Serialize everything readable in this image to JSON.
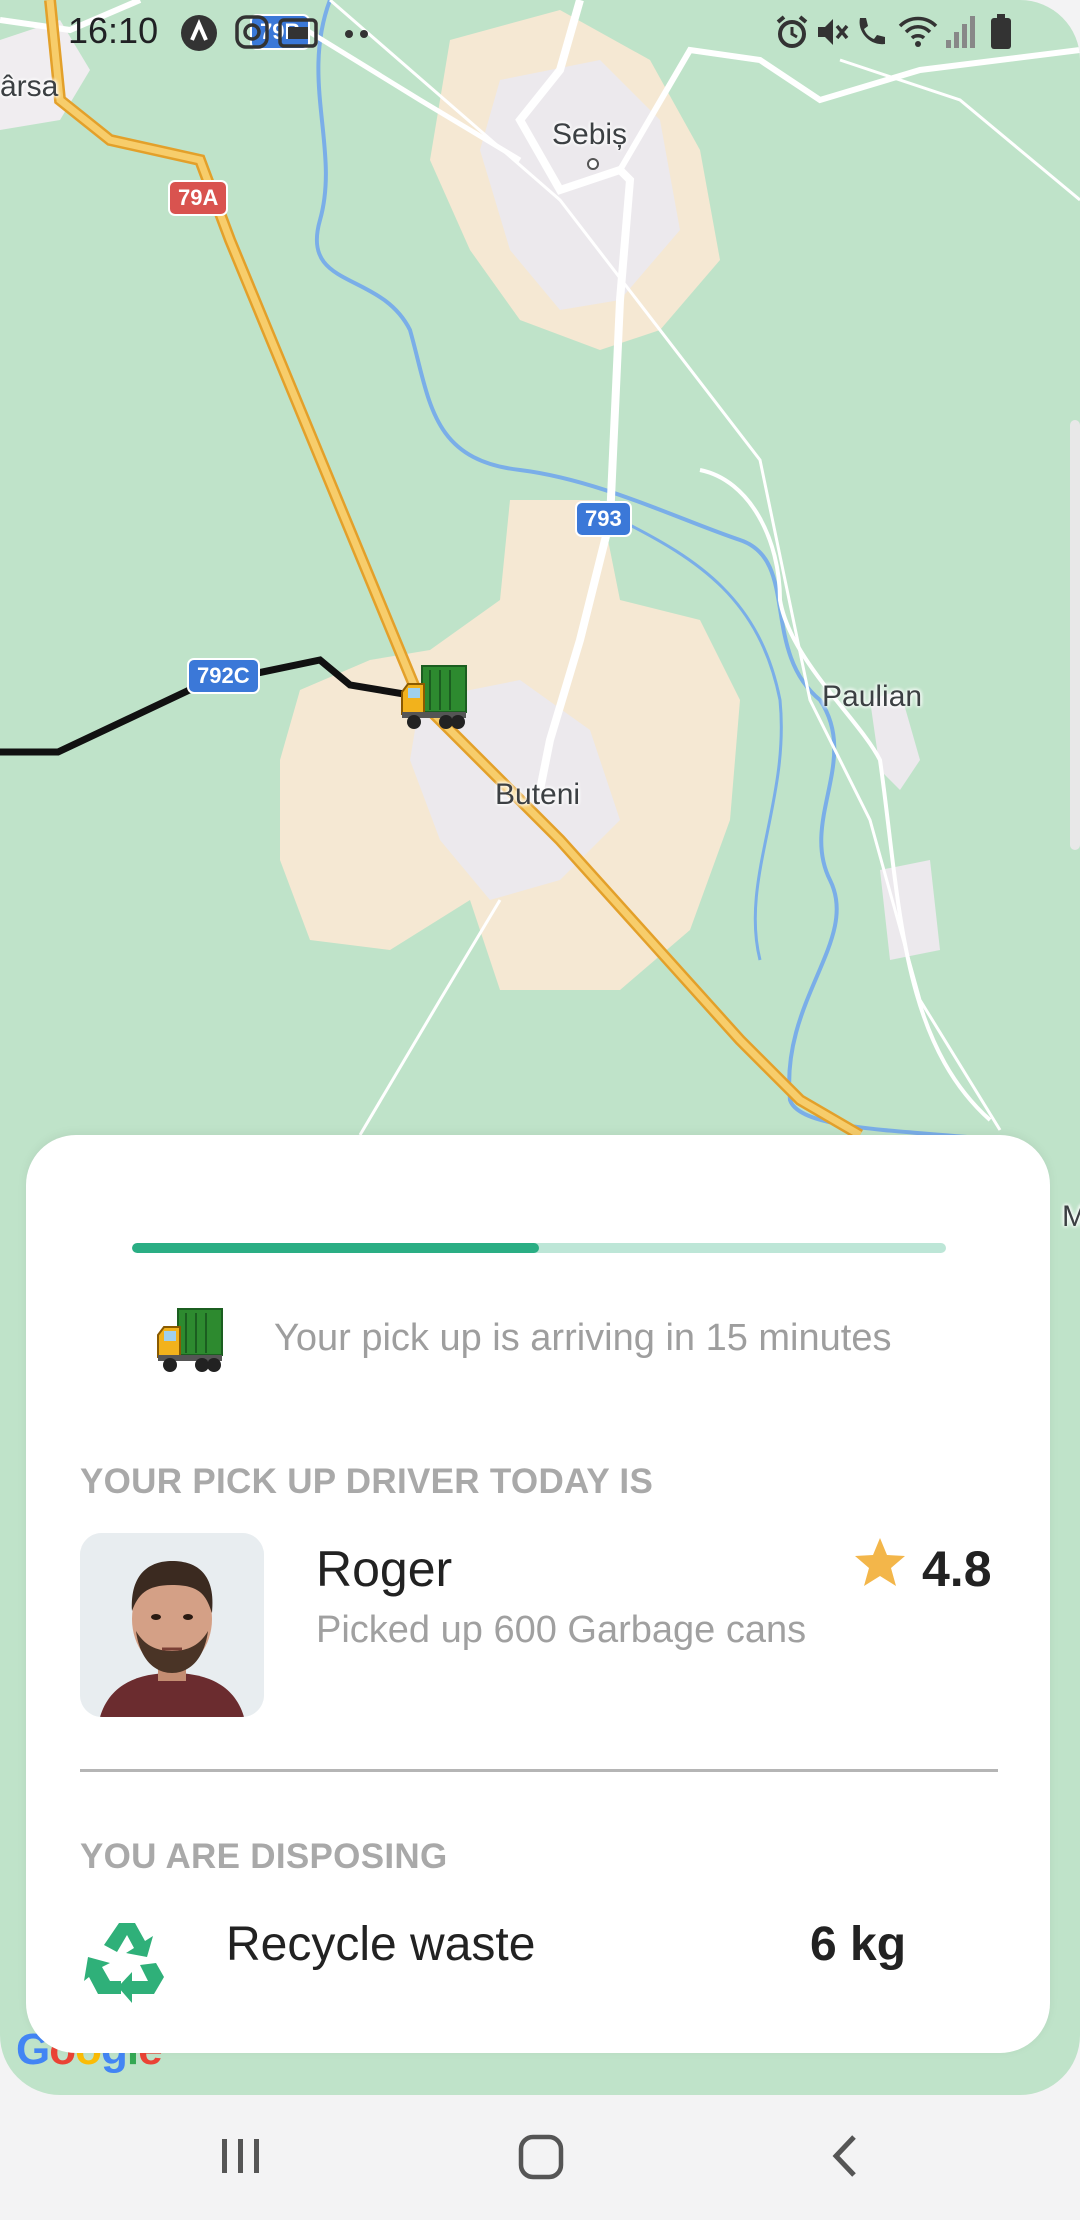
{
  "status_bar": {
    "time": "16:10",
    "icons": [
      "navigation-app-icon",
      "instagram-icon",
      "tv-icon",
      "more-dots-icon",
      "alarm-icon",
      "mute-icon",
      "wifi-call-icon",
      "wifi-icon",
      "signal-icon",
      "battery-icon"
    ]
  },
  "map": {
    "places": [
      "Sebiș",
      "Paulian",
      "Buteni",
      "ârsa",
      "M"
    ],
    "road_shields": [
      "79A",
      "793",
      "792C",
      "79B"
    ],
    "attribution": "Google",
    "colors": {
      "land": "#bfe3c9",
      "urban": "#f5e8d3",
      "built": "#ece9ed",
      "river": "#7aaee8",
      "highway": "#f2b746",
      "route": "#111111"
    }
  },
  "pickup": {
    "progress": 0.5,
    "arrival_message": "Your pick up is arriving in 15 minutes"
  },
  "driver": {
    "heading": "YOUR PICK UP DRIVER TODAY IS",
    "name": "Roger",
    "stats": "Picked up 600 Garbage cans",
    "rating": "4.8"
  },
  "disposal": {
    "heading": "YOU ARE DISPOSING",
    "waste_type": "Recycle waste",
    "weight": "6 kg"
  },
  "colors": {
    "accent": "#2aae84",
    "accent_light": "#bde6d7",
    "star": "#f3b64a",
    "recycle": "#2fb079"
  },
  "nav_bar": {
    "buttons": [
      "recents-icon",
      "home-icon",
      "back-icon"
    ]
  }
}
